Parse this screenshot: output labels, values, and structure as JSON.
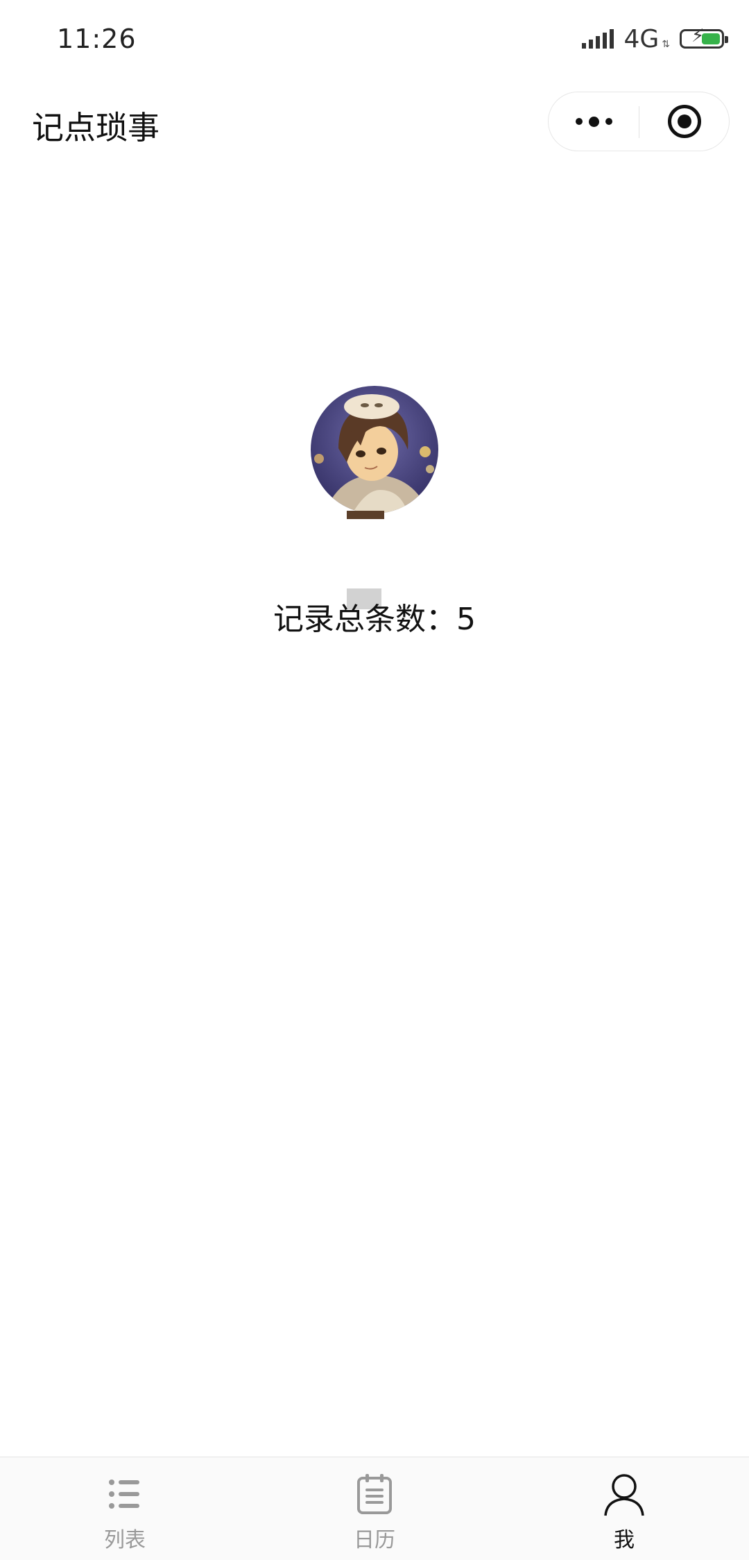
{
  "status_bar": {
    "time": "11:26",
    "network": "4G",
    "network_arrows": "⇅",
    "battery_color": "#36b24a"
  },
  "navbar": {
    "title": "记点琐事",
    "more_icon": "more-dots-icon",
    "close_icon": "target-circle-icon"
  },
  "profile": {
    "avatar_icon": "avatar-anime-character",
    "count_label": "记录总条数：5"
  },
  "tabbar": {
    "tabs": [
      {
        "label": "列表",
        "icon": "list-icon",
        "active": false
      },
      {
        "label": "日历",
        "icon": "calendar-icon",
        "active": false
      },
      {
        "label": "我",
        "icon": "user-icon",
        "active": true
      }
    ],
    "inactive_color": "#999999",
    "active_color": "#111111"
  }
}
